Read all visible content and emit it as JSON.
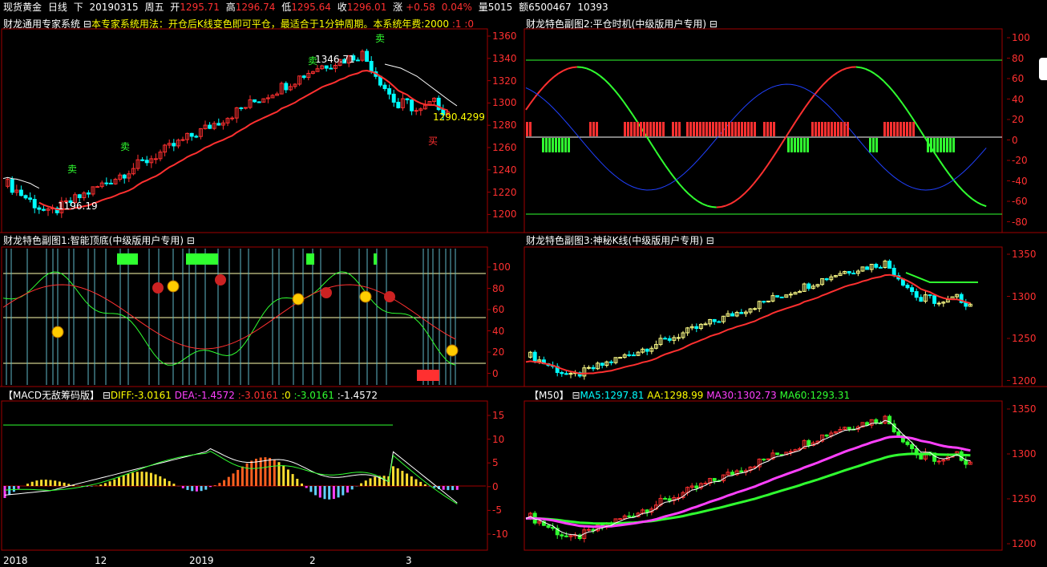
{
  "topbar": {
    "symbol": "现货黄金",
    "period": "日线",
    "dir": "下",
    "date": "20190315",
    "weekday": "周五",
    "open_label": "开",
    "open": "1295.71",
    "high_label": "高",
    "high": "1296.74",
    "low_label": "低",
    "low": "1295.64",
    "close_label": "收",
    "close": "1296.01",
    "change_label": "涨",
    "change": "+0.58",
    "change_pct": "0.04%",
    "volume_label": "量",
    "volume": "5015",
    "amount_label": "额",
    "amount": "6500467",
    "extra": "10393"
  },
  "panel_main": {
    "title": "财龙通用专家系统",
    "hint": "本专家系统用法：开仓后K线变色即可平仓，最适合于1分钟周期。本系统年费:2000",
    "p1": ":1",
    "p2": ":0",
    "y_ticks": [
      "1360",
      "1340",
      "1320",
      "1300",
      "1280",
      "1260",
      "1240",
      "1220",
      "1200"
    ],
    "high_label": "1346.71",
    "low_label": "1196.19",
    "last_label": "1290.4299",
    "sell_marks": [
      "卖",
      "卖",
      "卖",
      "卖"
    ],
    "buy_marks": [
      "买"
    ]
  },
  "panel_sub2": {
    "title": "财龙特色副图2:平仓时机(中级版用户专用)",
    "y_ticks": [
      "100",
      "80",
      "60",
      "40",
      "20",
      "0",
      "-20",
      "-40",
      "-60",
      "-80"
    ]
  },
  "panel_sub1": {
    "title": "财龙特色副图1:智能顶底(中级版用户专用)",
    "y_ticks": [
      "100",
      "80",
      "60",
      "40",
      "20",
      "0"
    ]
  },
  "panel_sub3": {
    "title": "财龙特色副图3:神秘K线(中级版用户专用)",
    "y_ticks": [
      "1350",
      "1300",
      "1250",
      "1200"
    ]
  },
  "panel_macd": {
    "title": "【MACD无敌筹码版】",
    "diff_label": "DIFF:",
    "diff": "-3.0161",
    "dea_label": "DEA:",
    "dea": "-1.4572",
    "v1": ":-3.0161",
    "v2": ":0",
    "v3": ":-3.0161",
    "v4": ":-1.4572",
    "y_ticks": [
      "15",
      "10",
      "5",
      "0",
      "-5",
      "-10"
    ]
  },
  "panel_ma": {
    "title": "【M50】",
    "ma5_label": "MA5:",
    "ma5": "1297.81",
    "aa_label": "AA:",
    "aa": "1298.99",
    "ma30_label": "MA30:",
    "ma30": "1302.73",
    "ma60_label": "MA60:",
    "ma60": "1293.31",
    "y_ticks": [
      "1350",
      "1300",
      "1250",
      "1200"
    ]
  },
  "x_axis": {
    "labels": [
      "2018",
      "12",
      "2019",
      "2",
      "3"
    ]
  },
  "colors": {
    "up": "#ff3030",
    "down": "#00ffff",
    "frame": "#a00000",
    "green_line": "#30ff30",
    "yellow": "#ffff00",
    "magenta": "#ff40ff",
    "blue": "#2040ff"
  }
}
